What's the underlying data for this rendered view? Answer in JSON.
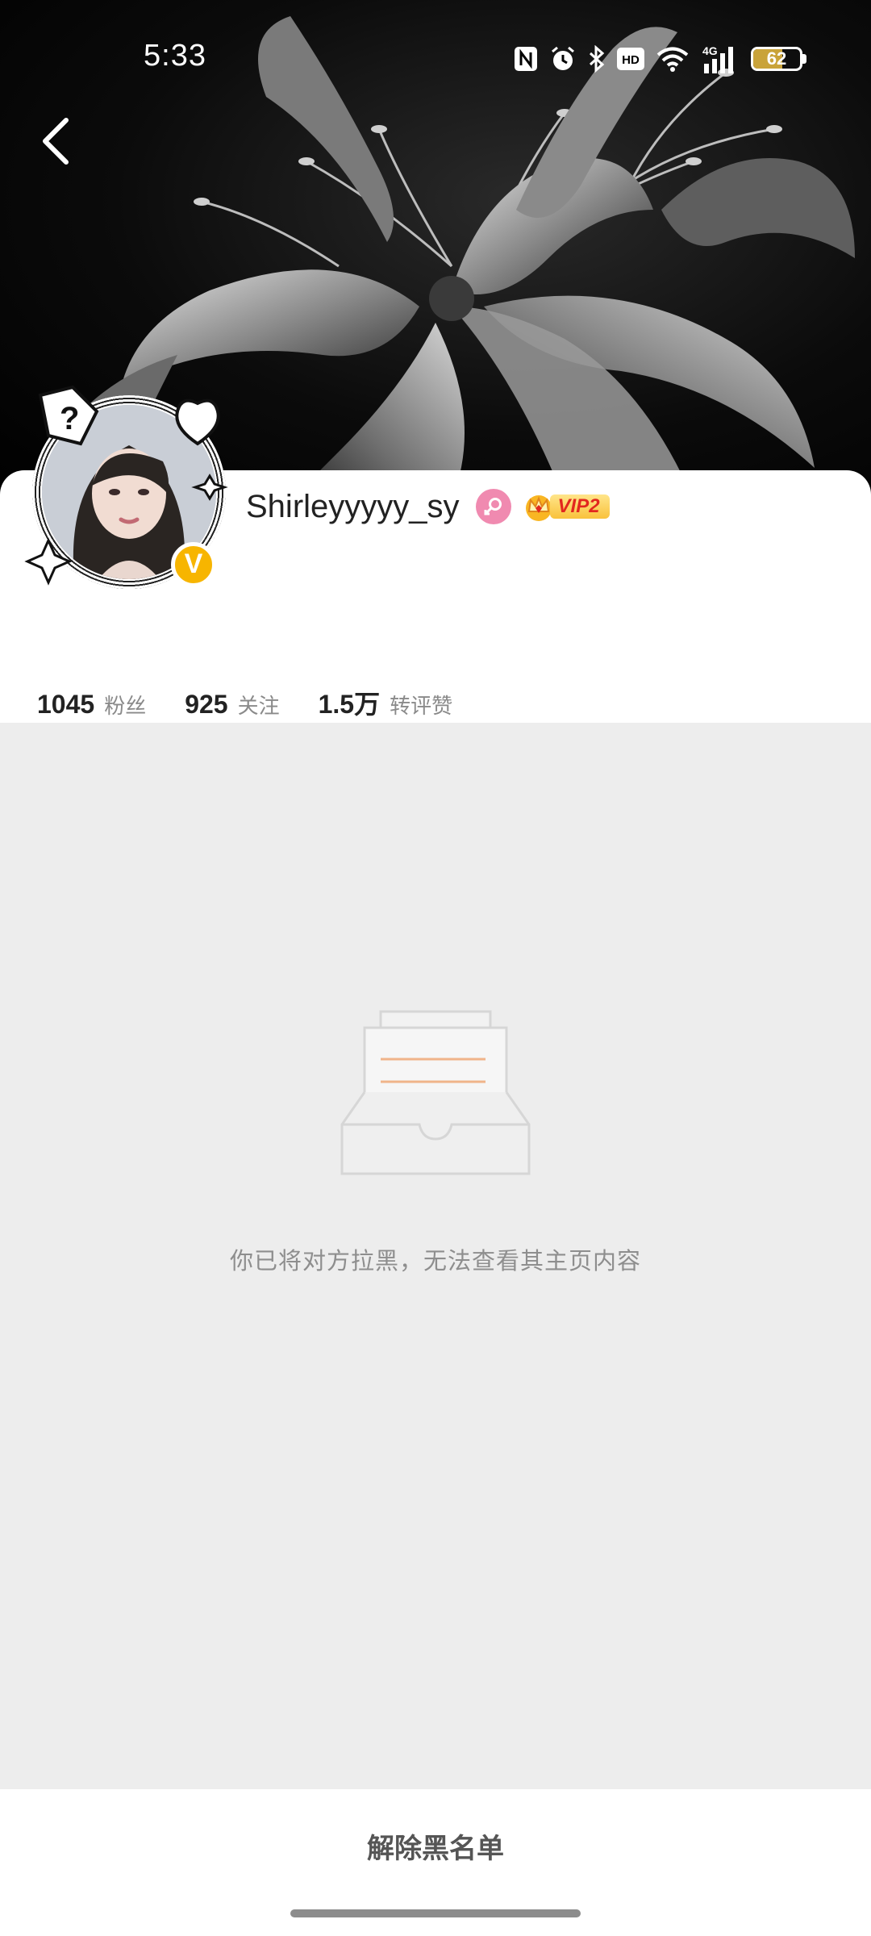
{
  "status_bar": {
    "time": "5:33",
    "battery_level": 62,
    "battery_text": "62",
    "icons": [
      "nfc-icon",
      "alarm-icon",
      "bluetooth-icon",
      "hd-icon",
      "wifi-icon",
      "signal-4g-icon",
      "battery-icon"
    ],
    "network_label": "4G",
    "hd_label": "HD"
  },
  "profile": {
    "username": "Shirleyyyyy_sy",
    "gender": "female",
    "vip_label": "VIP2",
    "verified_label": "V",
    "accent_color": "#f7b500"
  },
  "stats": [
    {
      "value": "1045",
      "label": "粉丝"
    },
    {
      "value": "925",
      "label": "关注"
    },
    {
      "value": "1.5万",
      "label": "转评赞"
    }
  ],
  "blocked": {
    "message": "你已将对方拉黑，无法查看其主页内容"
  },
  "actions": {
    "unblock_label": "解除黑名单"
  }
}
